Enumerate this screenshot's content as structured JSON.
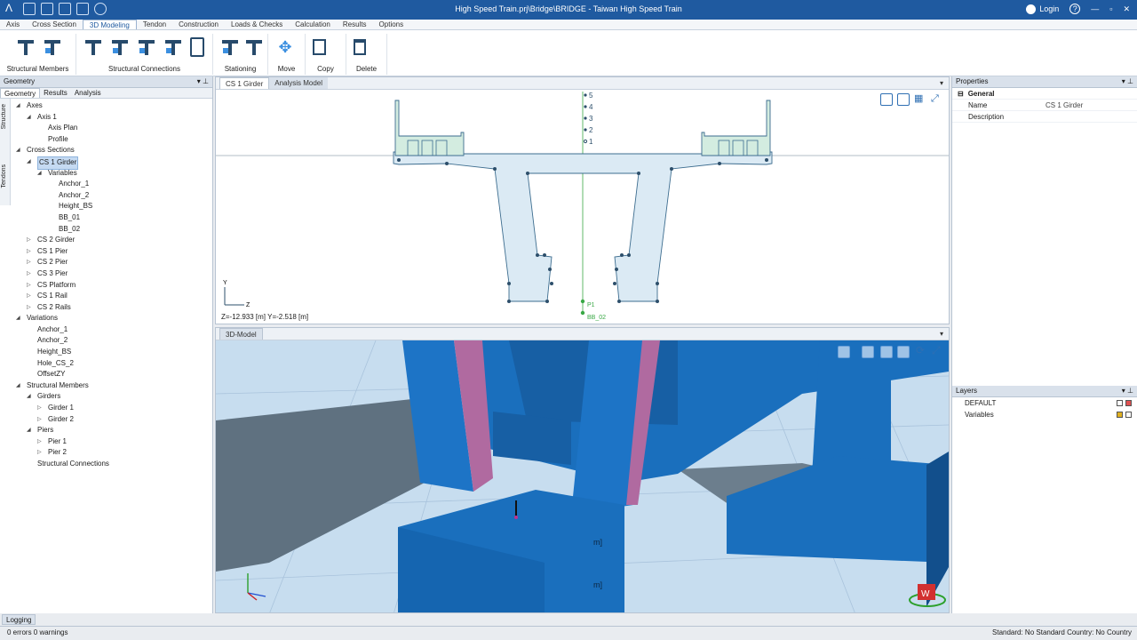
{
  "window": {
    "title": "High Speed Train.prj\\Bridge\\BRIDGE - Taiwan High Speed Train",
    "login_label": "Login",
    "help_label": "?"
  },
  "menu": [
    "Axis",
    "Cross Section",
    "3D Modeling",
    "Tendon",
    "Construction",
    "Loads & Checks",
    "Calculation",
    "Results",
    "Options"
  ],
  "ribbon": {
    "groups": [
      {
        "label": "Structural Members",
        "icons": [
          "member-icon",
          "member-alt-icon"
        ]
      },
      {
        "label": "Structural Connections",
        "icons": [
          "connection-icon",
          "connection-2-icon",
          "connection-3-icon",
          "connection-4-icon",
          "clipboard-icon"
        ]
      },
      {
        "label": "Stationing",
        "icons": [
          "stationing-icon",
          "stationing-2-icon"
        ]
      },
      {
        "label": "Move",
        "icons": [
          "move-icon"
        ]
      },
      {
        "label": "Copy",
        "icons": [
          "copy-icon"
        ]
      },
      {
        "label": "Delete",
        "icons": [
          "delete-icon"
        ]
      }
    ]
  },
  "left_panel": {
    "title": "Geometry",
    "tabs": [
      "Geometry",
      "Results",
      "Analysis"
    ],
    "side_tabs": [
      "Structure",
      "Tendons"
    ],
    "tree": [
      {
        "label": "Axes",
        "level": 0,
        "toggle": "expanded"
      },
      {
        "label": "Axis 1",
        "level": 1,
        "toggle": "expanded"
      },
      {
        "label": "Axis Plan",
        "level": 2,
        "toggle": "none"
      },
      {
        "label": "Profile",
        "level": 2,
        "toggle": "none"
      },
      {
        "label": "Cross Sections",
        "level": 0,
        "toggle": "expanded"
      },
      {
        "label": "CS 1 Girder",
        "level": 1,
        "toggle": "expanded",
        "selected": true
      },
      {
        "label": "Variables",
        "level": 2,
        "toggle": "expanded"
      },
      {
        "label": "Anchor_1",
        "level": 3,
        "toggle": "none"
      },
      {
        "label": "Anchor_2",
        "level": 3,
        "toggle": "none"
      },
      {
        "label": "Height_BS",
        "level": 3,
        "toggle": "none"
      },
      {
        "label": "BB_01",
        "level": 3,
        "toggle": "none"
      },
      {
        "label": "BB_02",
        "level": 3,
        "toggle": "none"
      },
      {
        "label": "CS 2 Girder",
        "level": 1,
        "toggle": "collapsed"
      },
      {
        "label": "CS 1 Pier",
        "level": 1,
        "toggle": "collapsed"
      },
      {
        "label": "CS 2 Pier",
        "level": 1,
        "toggle": "collapsed"
      },
      {
        "label": "CS 3 Pier",
        "level": 1,
        "toggle": "collapsed"
      },
      {
        "label": "CS Platform",
        "level": 1,
        "toggle": "collapsed"
      },
      {
        "label": "CS 1 Rail",
        "level": 1,
        "toggle": "collapsed"
      },
      {
        "label": "CS 2 Rails",
        "level": 1,
        "toggle": "collapsed"
      },
      {
        "label": "Variations",
        "level": 0,
        "toggle": "expanded"
      },
      {
        "label": "Anchor_1",
        "level": 1,
        "toggle": "none"
      },
      {
        "label": "Anchor_2",
        "level": 1,
        "toggle": "none"
      },
      {
        "label": "Height_BS",
        "level": 1,
        "toggle": "none"
      },
      {
        "label": "Hole_CS_2",
        "level": 1,
        "toggle": "none"
      },
      {
        "label": "OffsetZY",
        "level": 1,
        "toggle": "none"
      },
      {
        "label": "Structural Members",
        "level": 0,
        "toggle": "expanded"
      },
      {
        "label": "Girders",
        "level": 1,
        "toggle": "expanded"
      },
      {
        "label": "Girder 1",
        "level": 2,
        "toggle": "collapsed"
      },
      {
        "label": "Girder 2",
        "level": 2,
        "toggle": "collapsed"
      },
      {
        "label": "Piers",
        "level": 1,
        "toggle": "expanded"
      },
      {
        "label": "Pier 1",
        "level": 2,
        "toggle": "collapsed"
      },
      {
        "label": "Pier 2",
        "level": 2,
        "toggle": "collapsed"
      },
      {
        "label": "Structural Connections",
        "level": 1,
        "toggle": "none"
      }
    ]
  },
  "section_view": {
    "tabs": [
      "CS 1 Girder",
      "Analysis Model"
    ],
    "coords": "Z=-12.933 [m] Y=-2.518 [m]",
    "axis_y": "Y",
    "axis_z": "Z",
    "ref_labels": [
      "5",
      "4",
      "3",
      "2",
      "1"
    ],
    "point_label": "P1",
    "bottom_label": "BB_02"
  },
  "model_view": {
    "tab": "3D-Model",
    "annotation_1": "m]",
    "annotation_2": "m]",
    "view_cube_label": "W"
  },
  "properties": {
    "title": "Properties",
    "group": "General",
    "rows": [
      {
        "key": "Name",
        "value": "CS 1 Girder"
      },
      {
        "key": "Description",
        "value": ""
      }
    ]
  },
  "layers": {
    "title": "Layers",
    "items": [
      {
        "name": "DEFAULT",
        "color": "#e05050"
      },
      {
        "name": "Variables",
        "color": "#e0b020"
      }
    ]
  },
  "logging_tab": "Logging",
  "status": {
    "left": "0 errors 0 warnings",
    "right": "Standard: No Standard Country: No Country"
  }
}
